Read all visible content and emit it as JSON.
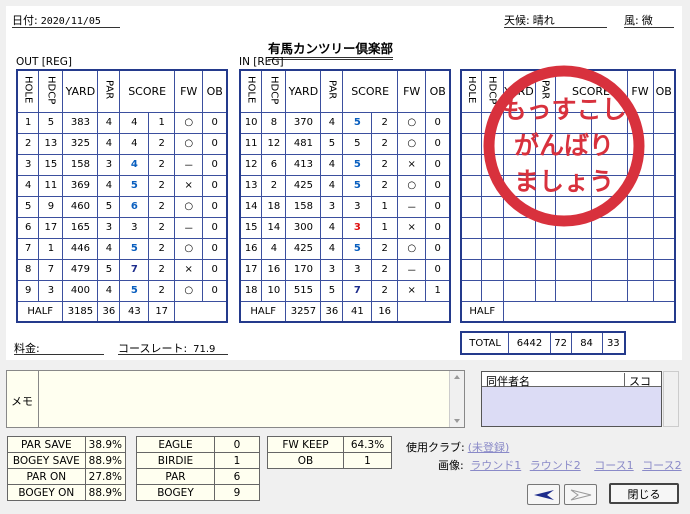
{
  "header": {
    "date_label": "日付:",
    "date": "2020/11/05",
    "weather_label": "天候:",
    "weather": "晴れ",
    "wind_label": "風:",
    "wind": "微",
    "course_name": "有馬カンツリー倶楽部"
  },
  "out": {
    "title": "OUT [REG]",
    "columns": [
      "HOLE",
      "HDCP",
      "YARD",
      "PAR",
      "SCORE",
      "FW",
      "OB"
    ],
    "rows": [
      {
        "hole": "1",
        "hdcp": "5",
        "yard": "383",
        "par": "4",
        "score": "4",
        "putt": "1",
        "fw": "○",
        "ob": "0",
        "c": "n"
      },
      {
        "hole": "2",
        "hdcp": "13",
        "yard": "325",
        "par": "4",
        "score": "4",
        "putt": "2",
        "fw": "○",
        "ob": "0",
        "c": "n"
      },
      {
        "hole": "3",
        "hdcp": "15",
        "yard": "158",
        "par": "3",
        "score": "4",
        "putt": "2",
        "fw": "－",
        "ob": "0",
        "c": "b"
      },
      {
        "hole": "4",
        "hdcp": "11",
        "yard": "369",
        "par": "4",
        "score": "5",
        "putt": "2",
        "fw": "×",
        "ob": "0",
        "c": "b"
      },
      {
        "hole": "5",
        "hdcp": "9",
        "yard": "460",
        "par": "5",
        "score": "6",
        "putt": "2",
        "fw": "○",
        "ob": "0",
        "c": "b"
      },
      {
        "hole": "6",
        "hdcp": "17",
        "yard": "165",
        "par": "3",
        "score": "3",
        "putt": "2",
        "fw": "－",
        "ob": "0",
        "c": "n"
      },
      {
        "hole": "7",
        "hdcp": "1",
        "yard": "446",
        "par": "4",
        "score": "5",
        "putt": "2",
        "fw": "○",
        "ob": "0",
        "c": "b"
      },
      {
        "hole": "8",
        "hdcp": "7",
        "yard": "479",
        "par": "5",
        "score": "7",
        "putt": "2",
        "fw": "×",
        "ob": "0",
        "c": "v"
      },
      {
        "hole": "9",
        "hdcp": "3",
        "yard": "400",
        "par": "4",
        "score": "5",
        "putt": "2",
        "fw": "○",
        "ob": "0",
        "c": "b"
      }
    ],
    "half": {
      "label": "HALF",
      "yard": "3185",
      "par": "36",
      "score": "43",
      "putt": "17"
    }
  },
  "in": {
    "title": "IN [REG]",
    "columns": [
      "HOLE",
      "HDCP",
      "YARD",
      "PAR",
      "SCORE",
      "FW",
      "OB"
    ],
    "rows": [
      {
        "hole": "10",
        "hdcp": "8",
        "yard": "370",
        "par": "4",
        "score": "5",
        "putt": "2",
        "fw": "○",
        "ob": "0",
        "c": "b"
      },
      {
        "hole": "11",
        "hdcp": "12",
        "yard": "481",
        "par": "5",
        "score": "5",
        "putt": "2",
        "fw": "○",
        "ob": "0",
        "c": "n"
      },
      {
        "hole": "12",
        "hdcp": "6",
        "yard": "413",
        "par": "4",
        "score": "5",
        "putt": "2",
        "fw": "×",
        "ob": "0",
        "c": "b"
      },
      {
        "hole": "13",
        "hdcp": "2",
        "yard": "425",
        "par": "4",
        "score": "5",
        "putt": "2",
        "fw": "○",
        "ob": "0",
        "c": "b"
      },
      {
        "hole": "14",
        "hdcp": "18",
        "yard": "158",
        "par": "3",
        "score": "3",
        "putt": "1",
        "fw": "－",
        "ob": "0",
        "c": "n"
      },
      {
        "hole": "15",
        "hdcp": "14",
        "yard": "300",
        "par": "4",
        "score": "3",
        "putt": "1",
        "fw": "×",
        "ob": "0",
        "c": "r"
      },
      {
        "hole": "16",
        "hdcp": "4",
        "yard": "425",
        "par": "4",
        "score": "5",
        "putt": "2",
        "fw": "○",
        "ob": "0",
        "c": "b"
      },
      {
        "hole": "17",
        "hdcp": "16",
        "yard": "170",
        "par": "3",
        "score": "3",
        "putt": "2",
        "fw": "－",
        "ob": "0",
        "c": "n"
      },
      {
        "hole": "18",
        "hdcp": "10",
        "yard": "515",
        "par": "5",
        "score": "7",
        "putt": "2",
        "fw": "×",
        "ob": "1",
        "c": "v"
      }
    ],
    "half": {
      "label": "HALF",
      "yard": "3257",
      "par": "36",
      "score": "41",
      "putt": "16"
    }
  },
  "extra": {
    "columns": [
      "HOLE",
      "HDCP",
      "YARD",
      "PAR",
      "SCORE",
      "FW",
      "OB"
    ],
    "half_label": "HALF",
    "total_label": "TOTAL",
    "total": {
      "yard": "6442",
      "par": "72",
      "score": "84",
      "putt": "33"
    }
  },
  "stamp": {
    "lines": [
      "もっすこし",
      "がんばり",
      "ましょう"
    ],
    "color": "#d8313d"
  },
  "fee": {
    "label": "料金:",
    "value": "",
    "rating_label": "コースレート:",
    "rating": "71.9"
  },
  "memo": {
    "label": "メモ",
    "value": ""
  },
  "companions": {
    "name_header": "同伴者名",
    "score_header": "スコア"
  },
  "stats1": [
    {
      "label": "PAR SAVE",
      "value": "38.9%"
    },
    {
      "label": "BOGEY SAVE",
      "value": "88.9%"
    },
    {
      "label": "PAR ON",
      "value": "27.8%"
    },
    {
      "label": "BOGEY ON",
      "value": "88.9%"
    }
  ],
  "stats2": [
    {
      "label": "EAGLE",
      "value": "0"
    },
    {
      "label": "BIRDIE",
      "value": "1"
    },
    {
      "label": "PAR",
      "value": "6"
    },
    {
      "label": "BOGEY",
      "value": "9"
    }
  ],
  "stats3": [
    {
      "label": "FW KEEP",
      "value": "64.3%"
    },
    {
      "label": "OB",
      "value": "1"
    }
  ],
  "clubs": {
    "label": "使用クラブ:",
    "value": "(未登録)"
  },
  "images": {
    "label": "画像:",
    "links": [
      "ラウンド1",
      "ラウンド2",
      "コース1",
      "コース2"
    ]
  },
  "buttons": {
    "close": "閉じる"
  },
  "colors": {
    "table_border": "#243a8c",
    "score_blue": "#0a5fbf",
    "score_red": "#e01010",
    "score_navy": "#1d2c8c",
    "companion_bg": "#dcdcf5"
  }
}
